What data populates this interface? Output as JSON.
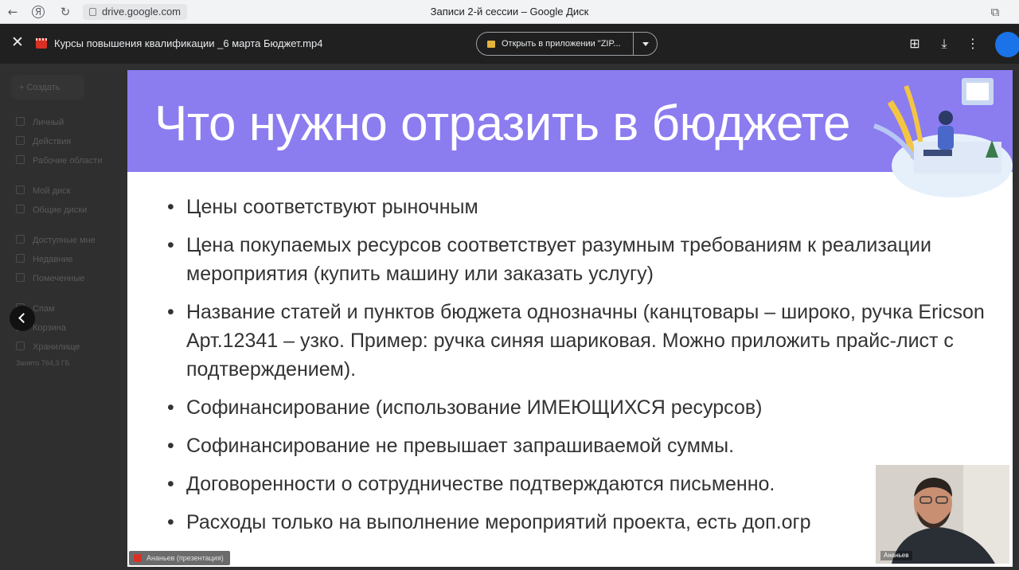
{
  "browser": {
    "url": "drive.google.com",
    "title": "Записи 2-й сессии – Google Диск"
  },
  "viewer": {
    "file_name": "Курсы повышения квалификации _6 марта Бюджет.mp4",
    "open_with_label": "Открыть в приложении \"ZIP...",
    "icons": [
      "close-icon",
      "add-shortcut-icon",
      "download-icon",
      "more-vert-icon"
    ]
  },
  "drive": {
    "create_label": "Создать",
    "nav": [
      "Личный",
      "Действия",
      "Рабочие области",
      "Мой диск",
      "Общие диски",
      "Доступные мне",
      "Недавние",
      "Помеченные",
      "Спам",
      "Корзина",
      "Хранилище"
    ],
    "storage": "Занято 764,3 ГБ"
  },
  "slide": {
    "title": "Что нужно отразить в бюджете",
    "bullets": [
      "Цены соответствуют рыночным",
      "Цена покупаемых ресурсов соответствует разумным требованиям к реализации мероприятия (купить машину или заказать услугу)",
      "Название статей и пунктов бюджета однозначны (канцтовары – широко, ручка Ericson Арт.12341 – узко. Пример: ручка синяя шариковая. Можно приложить прайс-лист с подтверждением).",
      "Софинансирование (использование ИМЕЮЩИХСЯ ресурсов)",
      "Софинансирование не превышает запрашиваемой суммы.",
      "Договоренности о сотрудничестве подтверждаются письменно.",
      "Расходы только на выполнение мероприятий проекта, есть доп.огр"
    ],
    "presenter_tag": "Ананьев (презентация)"
  },
  "webcam": {
    "name": "Ананьев"
  },
  "colors": {
    "slide_header": "#8b7cf0",
    "browser_bar": "#f1f3f4",
    "viewer_bar": "#202020"
  }
}
